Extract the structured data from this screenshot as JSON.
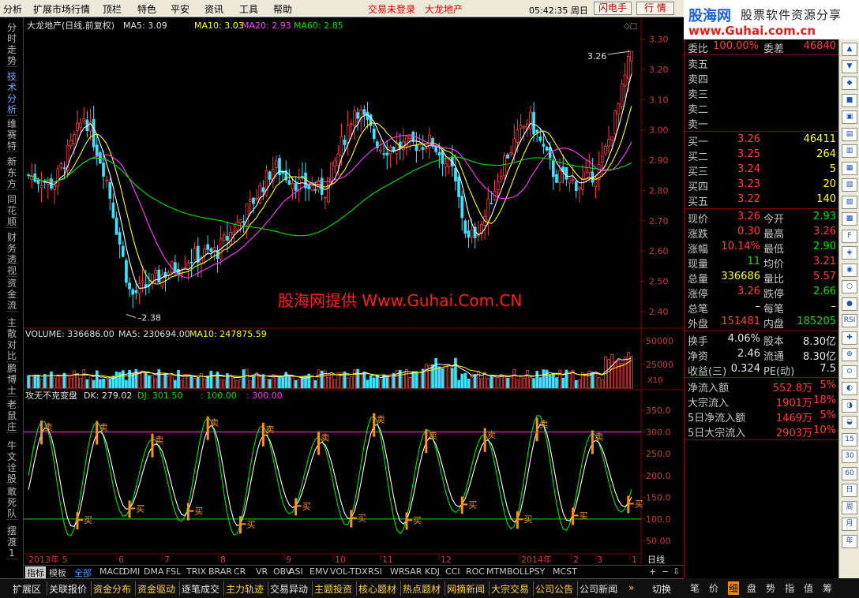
{
  "menu": {
    "items": [
      "分析",
      "扩展市场行情",
      "顶栏",
      "特色",
      "平安",
      "资讯",
      "工具",
      "帮助"
    ],
    "status_login": "交易未登录",
    "status_stock": "大龙地产",
    "clock": "05:42:35 周日",
    "btn_flash": "闪电手",
    "btn_quote": "行 情"
  },
  "logo": {
    "brand": "股海网",
    "slogan": "股票软件资源分享",
    "url": "www.Guhai.com.cn"
  },
  "left_tabs": [
    "分时走势",
    "技术分析",
    "维赛特",
    "新东方",
    "同花顺",
    "财务透视",
    "资金流",
    "主散对比",
    "鹏博士",
    "老鼠庄",
    "牛文诠股",
    "敢死队",
    "摆渡1"
  ],
  "main_panel": {
    "title": "大龙地产(日线,前复权)",
    "ma5": "MA5: 3.09",
    "ma10": "MA10: 3.03",
    "ma20": "MA20: 2.93",
    "ma60": "MA60: 2.85",
    "high_label": "3.26",
    "low_label": "2.38",
    "watermark": "股海网提供 Www.Guhai.Com.CN",
    "yticks": [
      "3.30",
      "3.20",
      "3.10",
      "3.00",
      "2.90",
      "2.80",
      "2.70",
      "2.60",
      "2.50",
      "2.40"
    ]
  },
  "volume_panel": {
    "volume": "VOLUME: 336686.00",
    "ma5": "MA5: 230694.00",
    "ma10": "MA10: 247875.59",
    "yticks": [
      "50000",
      "25000"
    ],
    "unit": "X10"
  },
  "indicator_panel": {
    "name": "攻无不克变盘",
    "dk": "DK: 279.02",
    "dj": "DJ: 301.50",
    "l100": ": 100.00",
    "l300": ": 300.00",
    "yticks": [
      "350.0",
      "300.0",
      "250.0",
      "200.0",
      "150.0",
      "100.0",
      "50.00"
    ],
    "sell_marker": "卖",
    "buy_marker": "买"
  },
  "x_axis": {
    "labels": [
      "2013年 5",
      "6",
      "7",
      "8",
      "9",
      "10",
      "11",
      "12",
      "2014年",
      "2",
      "3",
      "1"
    ],
    "period": "日线"
  },
  "indicator_tabs": [
    "指标",
    "模板",
    "全部",
    "MACD",
    "DMI",
    "DMA",
    "FSL",
    "TRIX",
    "BRAR",
    "CR",
    "VR",
    "OBV",
    "ASI",
    "EMV",
    "VOL-TDX",
    "RSI",
    "WR",
    "SAR",
    "KDJ",
    "CCI",
    "ROC",
    "MTM",
    "BOLL",
    "PSY",
    "MCST"
  ],
  "bottom_tabs": [
    "扩展区",
    "关联报价",
    "资金分布",
    "资金驱动",
    "逐笔成交",
    "主力轨迹",
    "交易异动",
    "主题投资",
    "核心题材",
    "热点题材",
    "网摘新闻",
    "大宗交易",
    "公司公告",
    "公司新闻"
  ],
  "bottom_switch": "切换",
  "right_tabs": [
    "笔",
    "价",
    "细",
    "盘",
    "势",
    "指",
    "值",
    "筹"
  ],
  "quote": {
    "wei_bi_label": "委比",
    "wei_bi_value": "100.00%",
    "wei_cha_label": "委差",
    "wei_cha_value": "46840",
    "sells": [
      {
        "label": "卖五"
      },
      {
        "label": "卖四"
      },
      {
        "label": "卖三"
      },
      {
        "label": "卖二"
      },
      {
        "label": "卖一"
      }
    ],
    "buys": [
      {
        "label": "买一",
        "price": "3.26",
        "volume": "46411"
      },
      {
        "label": "买二",
        "price": "3.25",
        "volume": "264"
      },
      {
        "label": "买三",
        "price": "3.24",
        "volume": "5"
      },
      {
        "label": "买四",
        "price": "3.23",
        "volume": "20"
      },
      {
        "label": "买五",
        "price": "3.22",
        "volume": "140"
      }
    ],
    "stats": [
      {
        "l1": "现价",
        "v1": "3.26",
        "c1": "red",
        "l2": "今开",
        "v2": "2.93",
        "c2": "green"
      },
      {
        "l1": "涨跌",
        "v1": "0.30",
        "c1": "red",
        "l2": "最高",
        "v2": "3.26",
        "c2": "red"
      },
      {
        "l1": "涨幅",
        "v1": "10.14%",
        "c1": "red",
        "l2": "最低",
        "v2": "2.90",
        "c2": "green"
      },
      {
        "l1": "现量",
        "v1": "11",
        "c1": "green",
        "l2": "均价",
        "v2": "3.21",
        "c2": "red"
      },
      {
        "l1": "总量",
        "v1": "336686",
        "c1": "yellow",
        "l2": "量比",
        "v2": "5.57",
        "c2": "red"
      },
      {
        "l1": "涨停",
        "v1": "3.26",
        "c1": "red",
        "l2": "跌停",
        "v2": "2.66",
        "c2": "green"
      },
      {
        "l1": "总笔",
        "v1": "–",
        "c1": "white",
        "l2": "每笔",
        "v2": "–",
        "c2": "white"
      },
      {
        "l1": "外盘",
        "v1": "151481",
        "c1": "red",
        "l2": "内盘",
        "v2": "185205",
        "c2": "green"
      }
    ],
    "stats2": [
      {
        "l1": "换手",
        "v1": "4.06%",
        "c1": "white",
        "l2": "股本",
        "v2": "8.30亿",
        "c2": "white"
      },
      {
        "l1": "净资",
        "v1": "2.46",
        "c1": "white",
        "l2": "流通",
        "v2": "8.30亿",
        "c2": "white"
      },
      {
        "l1": "收益(三)",
        "v1": "0.324",
        "c1": "white",
        "l2": "PE(动)",
        "v2": "7.5",
        "c2": "white"
      }
    ],
    "flows": [
      {
        "label": "净流入额",
        "value": "552.8万",
        "pct": "5%"
      },
      {
        "label": "大宗流入",
        "value": "1901万",
        "pct": "18%"
      },
      {
        "label": "5日净流入额",
        "value": "1469万",
        "pct": "5%"
      },
      {
        "label": "5日大宗流入",
        "value": "2903万",
        "pct": "10%"
      }
    ]
  },
  "tools": [
    "▲",
    "▼",
    "◆",
    "■",
    "▣",
    "▤",
    "▥",
    "▦",
    "▧",
    "▨",
    "▩",
    "F",
    "◈",
    "◉",
    "○",
    "●",
    "RSI",
    "✚",
    "⊕",
    "⊙",
    "◐",
    "◑",
    "◒",
    "15",
    "30",
    "60",
    "日",
    "周",
    "月",
    "年"
  ],
  "colors": {
    "up": "#ff4040",
    "down": "#40e0ff",
    "ma5": "#ffffff",
    "ma10": "#ffff00",
    "ma20": "#ff40ff",
    "ma60": "#00e000",
    "grid": "#800000",
    "marker": "#ff9020"
  }
}
